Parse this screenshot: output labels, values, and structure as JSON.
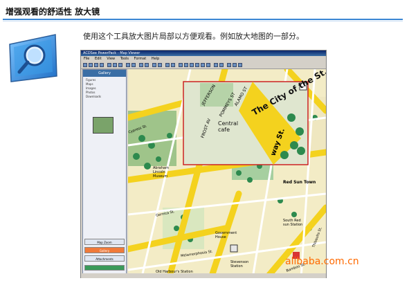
{
  "header": {
    "title": "增强观看的舒适性  放大镜"
  },
  "description": "使用这个工具放大图片局部以方便观看。例如放大地图的一部分。",
  "app": {
    "window_title": "ACDSee PowerPack - Map Viewer",
    "menu": [
      "File",
      "Edit",
      "View",
      "Tools",
      "Format",
      "Help"
    ],
    "sidebar": {
      "header": "Gallery",
      "tree_items": [
        "Figures",
        "Maps",
        "Images",
        "Photos",
        "Downloads"
      ],
      "buttons": [
        "Map Zoom",
        "Gallery",
        "Attachments"
      ]
    },
    "map_labels": {
      "city_st": "The City of the St.",
      "central_cafe": "Central cafe",
      "jefferson": "JEFFERSON",
      "pommeys": "POMMEYS ST",
      "alamo": "ALAMO ST",
      "frost": "FROST AV",
      "cypress": "Cypress St.",
      "abraham": "Abraham Lincoln Museum",
      "gernica": "Gernica St.",
      "wilkins": "Wilkins St.",
      "tom_sawyer": "Tom Sawyer St.",
      "melanophosia": "Melamorphosia St.",
      "government": "Government House",
      "gambla": "Gambla St.",
      "south_redsun": "South Red sun Station",
      "stevenson": "Stevenson Station",
      "old_harbour": "Old Harbour's Station",
      "red_sun_town": "Red Sun Town",
      "thibaults": "Thibaults St.",
      "bamboo": "Bamboo St.",
      "lamb": "Lamb St.",
      "pluton": "Pluton St.",
      "broadway": "way St.",
      "st6": "6th St.",
      "walk": "Walka St."
    }
  },
  "watermark": "alibaba.com.cn"
}
